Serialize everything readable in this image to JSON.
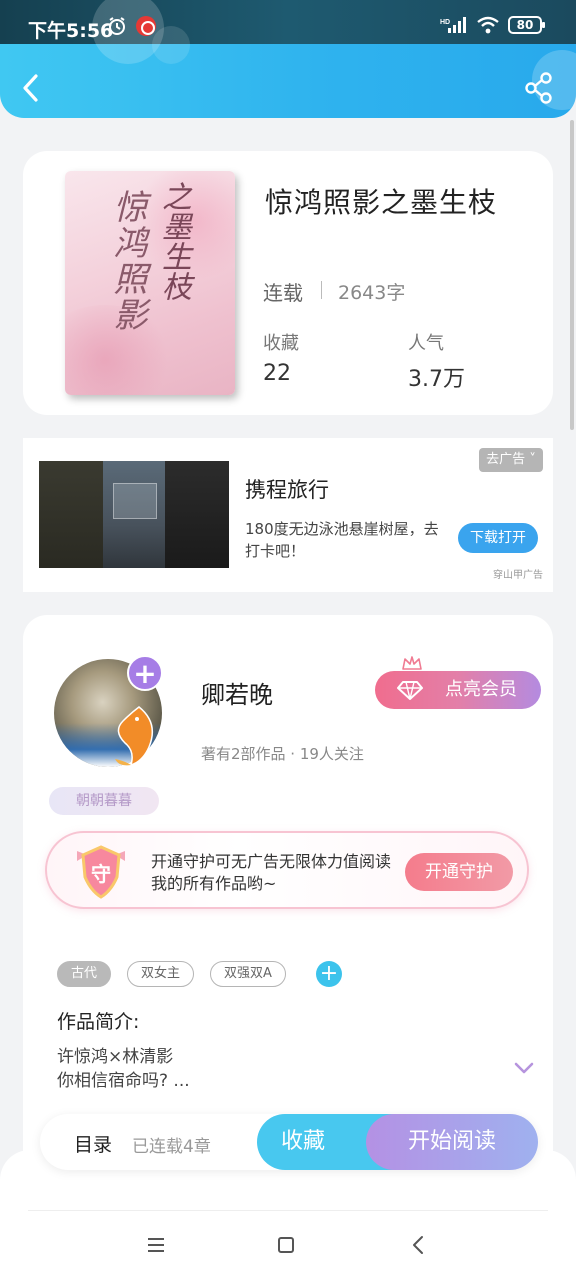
{
  "status_bar": {
    "time": "下午5:56",
    "battery": "80"
  },
  "header": {
    "back_icon": "chevron-left-icon",
    "share_icon": "share-icon"
  },
  "book": {
    "title": "惊鸿照影之墨生枝",
    "cover_text_1": "惊鸿照影",
    "cover_text_2": "之墨生枝",
    "status": "连载",
    "words": "2643字",
    "favorites_label": "收藏",
    "favorites_value": "22",
    "popularity_label": "人气",
    "popularity_value": "3.7万"
  },
  "ad": {
    "close_label": "去广告",
    "title": "携程旅行",
    "description": "180度无边泳池悬崖树屋，去打卡吧！",
    "button_label": "下载打开",
    "source": "穿山甲广告"
  },
  "author": {
    "name": "卿若晚",
    "meta": "著有2部作品 · 19人关注",
    "tag": "朝朝暮暮",
    "vip_label": "点亮会员",
    "guard_text": "开通守护可无广告无限体力值阅读我的所有作品哟~",
    "guard_shield_char": "守",
    "guard_button": "开通守护"
  },
  "tags": [
    "古代",
    "双女主",
    "双强双A"
  ],
  "intro": {
    "label": "作品简介:",
    "line1": "许惊鸿×林清影",
    "line2": "你相信宿命吗? ..."
  },
  "actions": {
    "toc_label": "目录",
    "toc_count": "已连载4章",
    "favorite_label": "收藏",
    "read_label": "开始阅读"
  },
  "colors": {
    "accent": "#2fb3ee",
    "vip_pink": "#f06d8e",
    "purple": "#a67de6"
  }
}
